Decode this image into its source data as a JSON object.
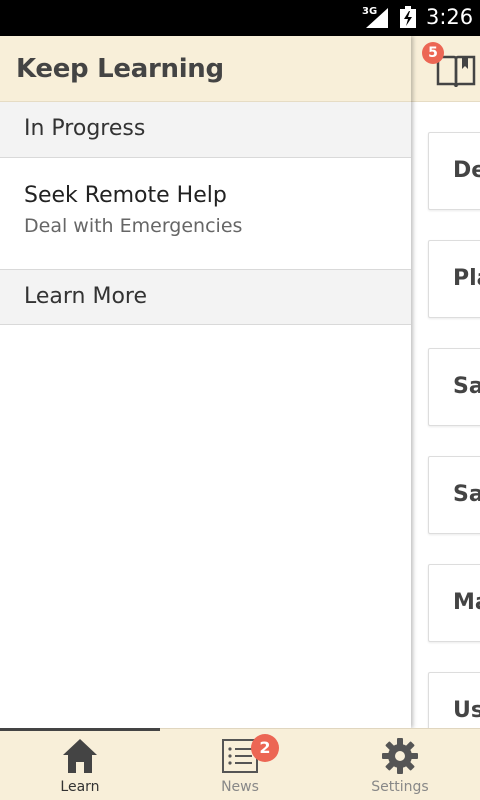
{
  "status_bar": {
    "network": "3G",
    "time": "3:26"
  },
  "drawer": {
    "title": "Keep Learning",
    "sections": [
      {
        "header": "In Progress",
        "items": [
          {
            "title": "Seek Remote Help",
            "subtitle": "Deal with Emergencies"
          }
        ]
      },
      {
        "header": "Learn More",
        "items": []
      }
    ]
  },
  "background_panel": {
    "book_badge_count": "5",
    "card_labels": [
      "De",
      "Pla",
      "Sa",
      "Sa",
      "Ma",
      "Us"
    ]
  },
  "bottom_nav": {
    "tabs": [
      {
        "label": "Learn",
        "icon": "home-icon",
        "selected": true
      },
      {
        "label": "News",
        "icon": "news-list-icon",
        "badge": "2",
        "selected": false
      },
      {
        "label": "Settings",
        "icon": "gear-icon",
        "selected": false
      }
    ]
  },
  "colors": {
    "header_bg": "#f8efd9",
    "badge": "#ec6654",
    "section_bg": "#f3f3f3"
  }
}
